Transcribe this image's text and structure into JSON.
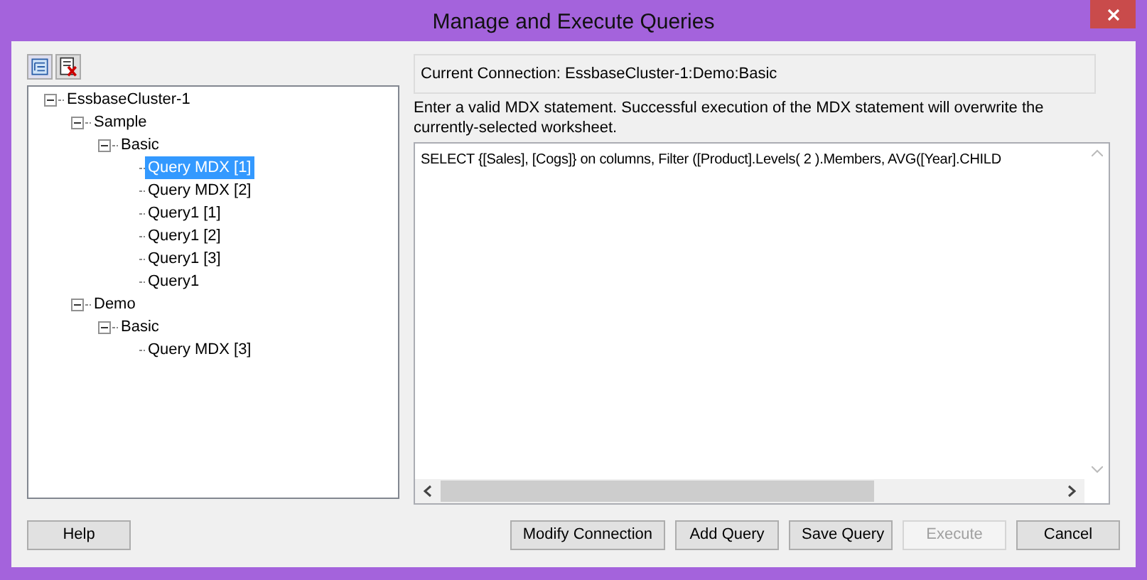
{
  "window": {
    "title": "Manage and Execute Queries"
  },
  "tree": [
    {
      "label": "EssbaseCluster-1",
      "expanded": true,
      "selected": false,
      "children": [
        {
          "label": "Sample",
          "expanded": true,
          "selected": false,
          "children": [
            {
              "label": "Basic",
              "expanded": true,
              "selected": false,
              "children": [
                {
                  "label": "Query MDX [1]",
                  "selected": true
                },
                {
                  "label": "Query MDX [2]",
                  "selected": false
                },
                {
                  "label": "Query1 [1]",
                  "selected": false
                },
                {
                  "label": "Query1 [2]",
                  "selected": false
                },
                {
                  "label": "Query1 [3]",
                  "selected": false
                },
                {
                  "label": "Query1",
                  "selected": false
                }
              ]
            }
          ]
        },
        {
          "label": "Demo",
          "expanded": true,
          "selected": false,
          "children": [
            {
              "label": "Basic",
              "expanded": true,
              "selected": false,
              "children": [
                {
                  "label": "Query MDX [3]",
                  "selected": false
                }
              ]
            }
          ]
        }
      ]
    }
  ],
  "connection": "Current Connection: EssbaseCluster-1:Demo:Basic",
  "instructions": "Enter a valid MDX statement. Successful execution of the MDX statement will overwrite the currently-selected worksheet.",
  "query": "SELECT {[Sales], [Cogs]} on columns, Filter ([Product].Levels( 2 ).Members, AVG([Year].CHILD",
  "buttons": [
    {
      "label": "Help",
      "disabled": false
    },
    {
      "label": "Modify Connection",
      "disabled": false
    },
    {
      "label": "Add Query",
      "disabled": false
    },
    {
      "label": "Save Query",
      "disabled": false
    },
    {
      "label": "Execute",
      "disabled": true
    },
    {
      "label": "Cancel",
      "disabled": false
    }
  ]
}
